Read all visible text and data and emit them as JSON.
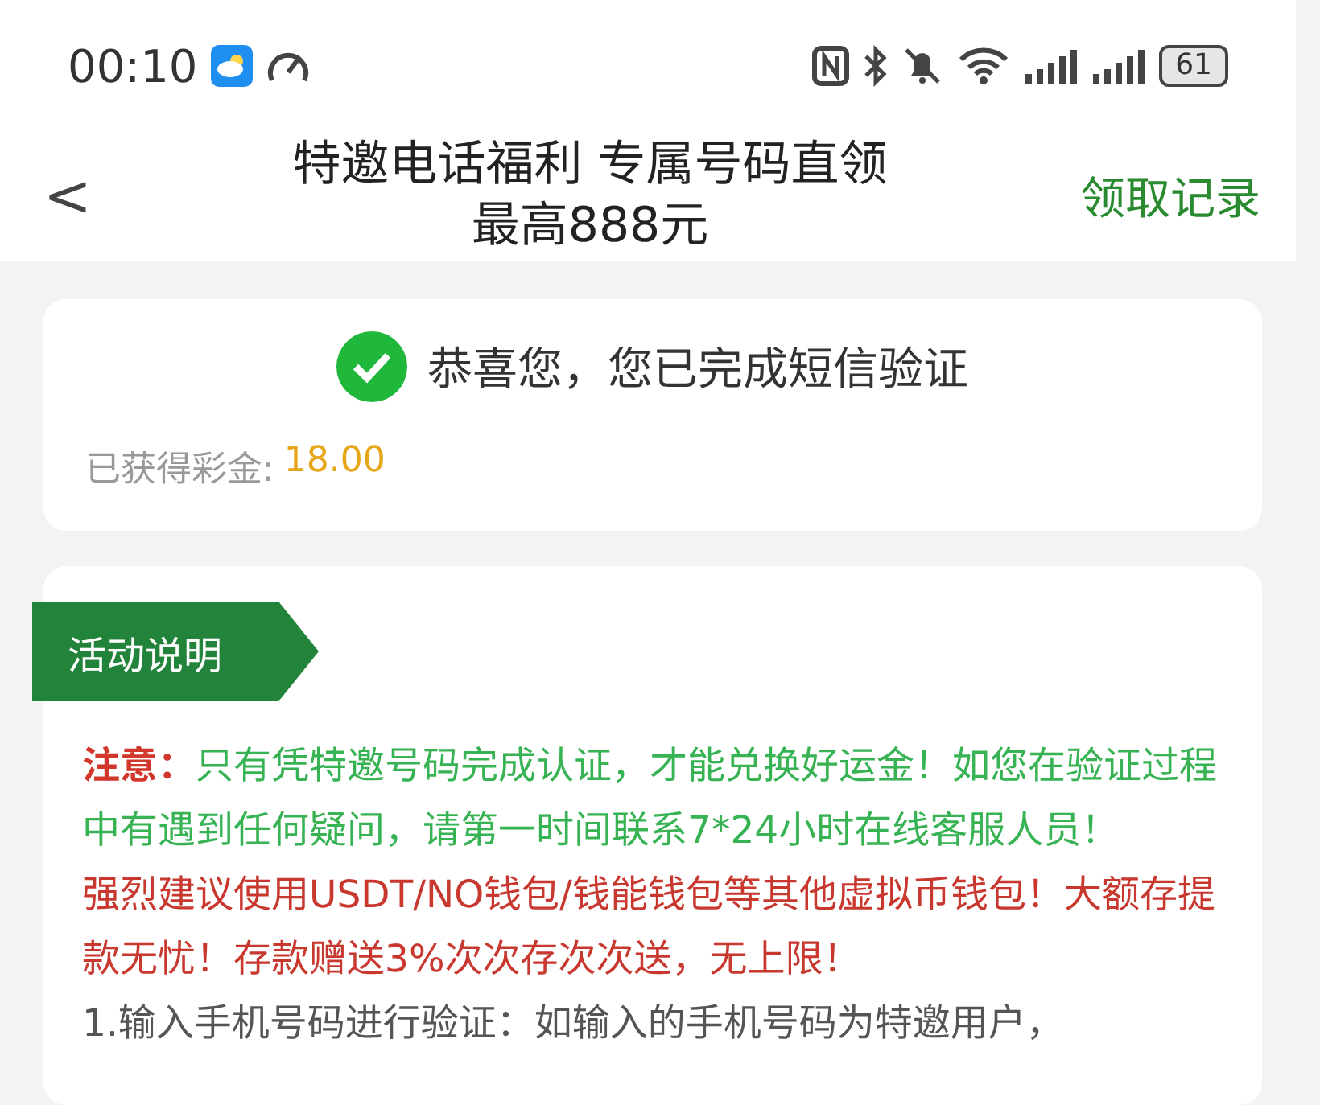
{
  "status_bar": {
    "time": "00:10",
    "battery": "61"
  },
  "header": {
    "back": "<",
    "title": "特邀电话福利 专属号码直领最高888元",
    "action": "领取记录"
  },
  "verify_card": {
    "checked": true,
    "message": "恭喜您，您已完成短信验证",
    "bonus_label": "已获得彩金:",
    "bonus_value": "18.00"
  },
  "info_card": {
    "tag": "活动说明",
    "paragraphs": [
      {
        "kind": "notice",
        "text": "**注意：**只有凭特邀号码完成认证，才能兑换好运金！如您在验证过程中有遇到任何疑问，请第一时间联系7*24小时在线客服人员！"
      },
      {
        "kind": "warning",
        "text": "强烈建议使用USDT/NO钱包/钱能钱包等其他虚拟币钱包！大额存提款无忧！存款赠送3%次次存次次送，无上限！"
      },
      {
        "kind": "step",
        "text": "1.输入手机号码进行验证：如输入的手机号码为特邀用户，"
      }
    ]
  }
}
